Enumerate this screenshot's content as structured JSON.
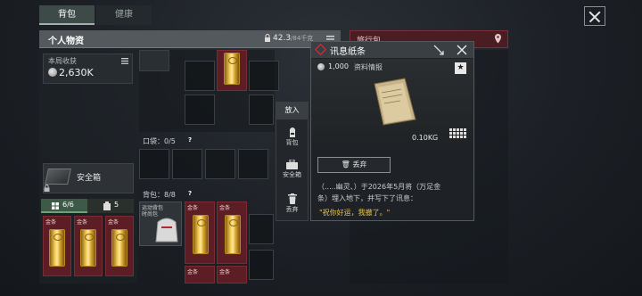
{
  "tabs": {
    "bag": "背包",
    "health": "健康"
  },
  "personal": {
    "title": "个人物资",
    "weight": "42.3",
    "weight_max": "/84千克"
  },
  "travel": {
    "title": "旅行包"
  },
  "income": {
    "label": "本局收获",
    "value": "2,630K"
  },
  "safe": {
    "label": "安全箱"
  },
  "counters": {
    "left": "6/6",
    "right": "5"
  },
  "gold_tag": "金条",
  "pocket": {
    "label": "口袋：",
    "count": "0/5",
    "q": "?"
  },
  "bag": {
    "label": "背包：",
    "count": "8/8",
    "q": "?"
  },
  "backpack_item": {
    "label": "运动背包",
    "label2": "时尚包"
  },
  "actions": {
    "put": "放入",
    "bag": "背包",
    "safe": "安全箱",
    "discard": "丢弃"
  },
  "popup": {
    "title": "讯息纸条",
    "price": "1,000",
    "category": "资料情报",
    "weight": "0.10KG",
    "discard": "丢弃",
    "desc_line1": "（.....幽灵、）于2026年5月将（万足金",
    "desc_line2": "条）埋入地下，并写下了讯息：",
    "quote": "\"祝你好运，我撤了。\""
  },
  "colors": {
    "accent_green": "#3c5a46",
    "gold_card": "#5c1d24",
    "rare_red": "#e0303a",
    "quote_yellow": "#e7c550"
  }
}
